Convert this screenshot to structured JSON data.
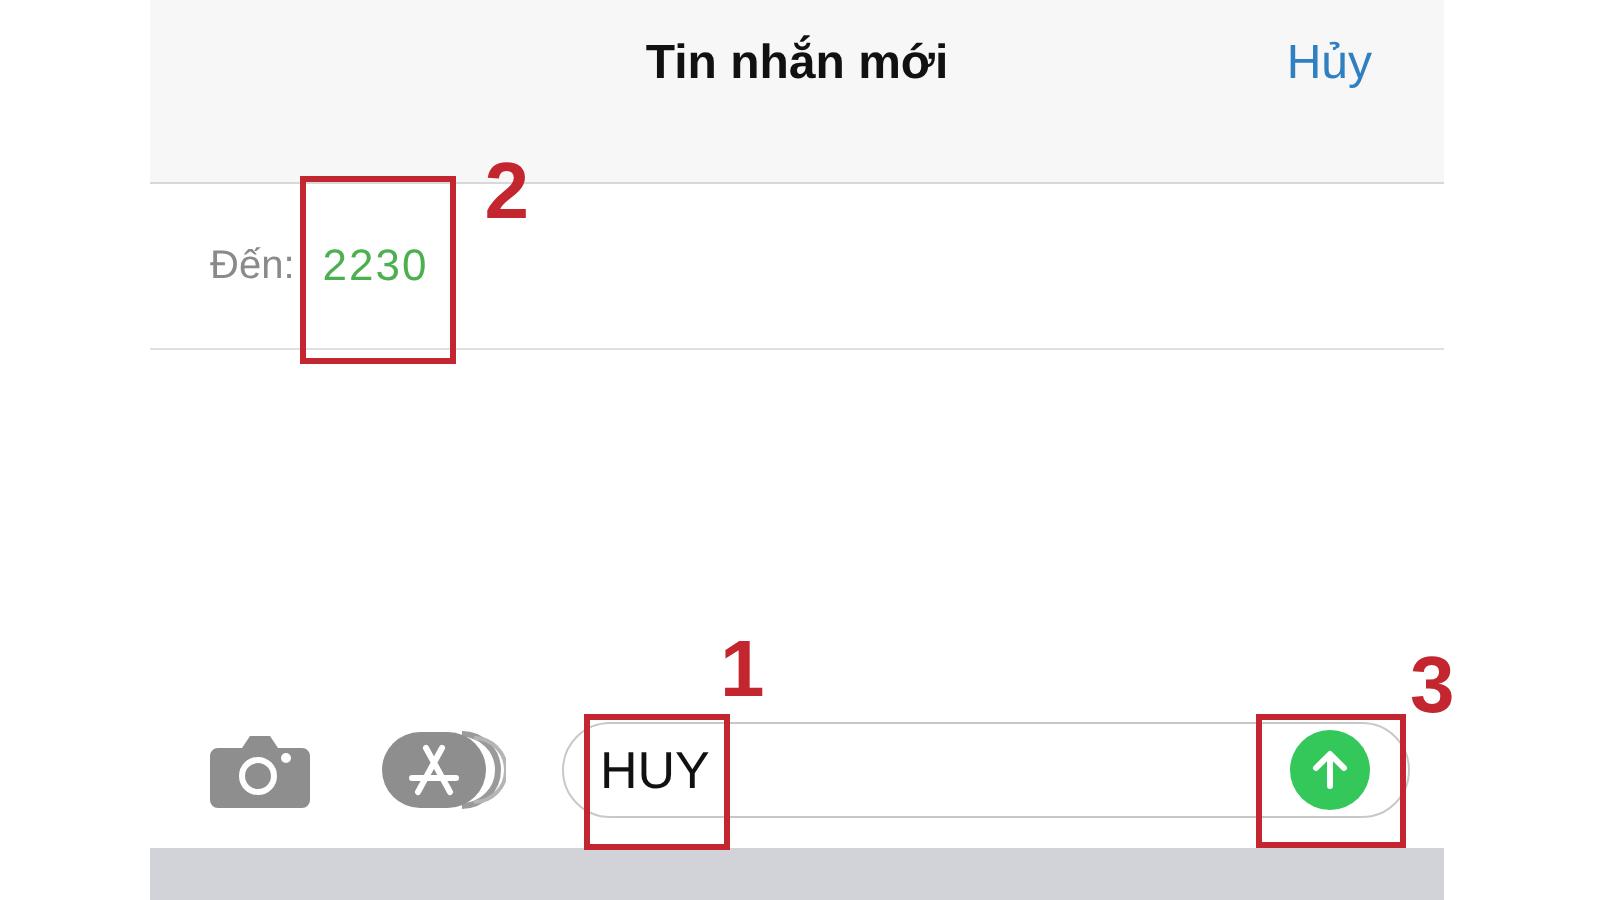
{
  "header": {
    "title": "Tin nhắn mới",
    "cancel": "Hủy"
  },
  "recipient": {
    "label": "Đến:",
    "value": "2230",
    "callout": "2"
  },
  "composer": {
    "message": {
      "value": "HUY",
      "callout": "1"
    },
    "send_callout": "3"
  }
}
